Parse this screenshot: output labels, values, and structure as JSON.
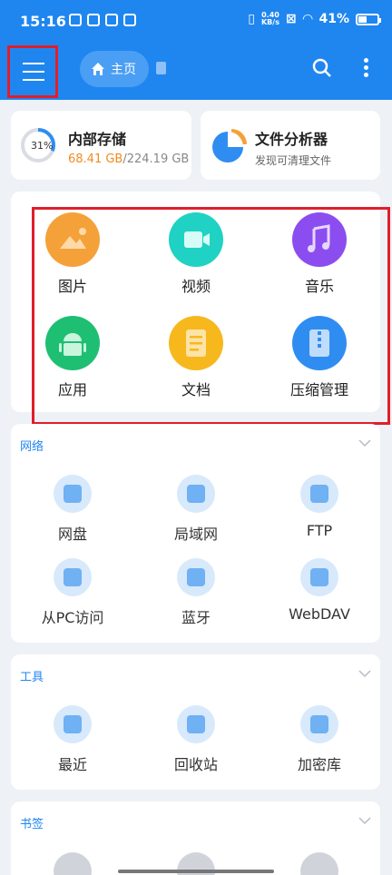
{
  "status_bar": {
    "time": "15:16",
    "net_speed_value": "0.40",
    "net_speed_unit": "KB/s",
    "battery": "41%",
    "battery_level": 0.41
  },
  "header": {
    "home_tab_label": "主页"
  },
  "storage": {
    "title": "内部存储",
    "percent": "31%",
    "percent_value": 31,
    "used": "68.41 GB",
    "total": "/224.19 GB",
    "accent": "#f08c1c"
  },
  "analyzer": {
    "title": "文件分析器",
    "subtitle": "发现可清理文件"
  },
  "categories": [
    {
      "label": "图片",
      "icon": "image-icon",
      "color": "#f5a13a"
    },
    {
      "label": "视频",
      "icon": "video-icon",
      "color": "#1fd2c3"
    },
    {
      "label": "音乐",
      "icon": "music-icon",
      "color": "#8b4df0"
    },
    {
      "label": "应用",
      "icon": "android-icon",
      "color": "#1fbf73"
    },
    {
      "label": "文档",
      "icon": "document-icon",
      "color": "#f7b81e"
    },
    {
      "label": "压缩管理",
      "icon": "archive-icon",
      "color": "#2f8df2"
    }
  ],
  "network": {
    "title": "网络",
    "items": [
      {
        "label": "网盘",
        "icon": "cloud-drive-icon"
      },
      {
        "label": "局域网",
        "icon": "lan-icon"
      },
      {
        "label": "FTP",
        "icon": "ftp-icon"
      },
      {
        "label": "从PC访问",
        "icon": "pc-access-icon"
      },
      {
        "label": "蓝牙",
        "icon": "bluetooth-icon"
      },
      {
        "label": "WebDAV",
        "icon": "webdav-icon"
      }
    ]
  },
  "tools": {
    "title": "工具",
    "items": [
      {
        "label": "最近",
        "icon": "recent-icon"
      },
      {
        "label": "回收站",
        "icon": "recycle-bin-icon"
      },
      {
        "label": "加密库",
        "icon": "vault-icon"
      }
    ]
  },
  "bookmarks": {
    "title": "书签"
  },
  "colors": {
    "primary": "#1f86f0",
    "highlight": "#e01e2a"
  }
}
